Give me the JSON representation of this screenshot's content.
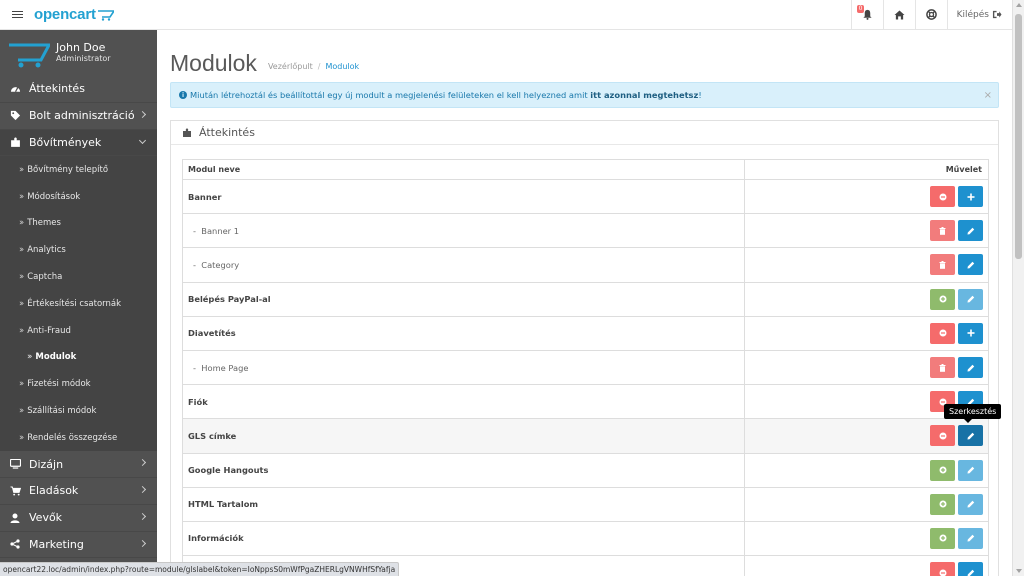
{
  "header": {
    "logo_text": "opencart",
    "notification_count": "0",
    "logout_label": "Kilépés"
  },
  "sidebar": {
    "user_name": "John Doe",
    "user_role": "Administrator",
    "items": [
      {
        "label": "Áttekintés",
        "icon": "dashboard-icon"
      },
      {
        "label": "Bolt adminisztráció",
        "icon": "tag-icon",
        "has_chevron": true
      },
      {
        "label": "Bővítmények",
        "icon": "puzzle-icon",
        "has_chevron": true,
        "open": true
      }
    ],
    "sub_items": [
      "Bővítmény telepítő",
      "Módosítások",
      "Themes",
      "Analytics",
      "Captcha",
      "Értékesítési csatornák",
      "Anti-Fraud",
      "Modulok",
      "Fizetési módok",
      "Szállítási módok",
      "Rendelés összegzése"
    ],
    "items_after": [
      {
        "label": "Dizájn",
        "icon": "desktop-icon"
      },
      {
        "label": "Eladások",
        "icon": "shopping-cart-icon"
      },
      {
        "label": "Vevők",
        "icon": "user-icon"
      },
      {
        "label": "Marketing",
        "icon": "share-icon"
      }
    ]
  },
  "page": {
    "title": "Modulok",
    "breadcrumb_home": "Vezérlőpult",
    "breadcrumb_current": "Modulok",
    "alert_text": "Miután létrehoztál és beállítottál egy új modult a megjelenési felületeken el kell helyezned amit ",
    "alert_bold": "itt azonnal megtehetsz",
    "alert_end": "!",
    "alert_close": "×",
    "panel_title": "Áttekintés"
  },
  "table": {
    "col_name": "Modul neve",
    "col_action": "Művelet",
    "rows": [
      {
        "name": "Banner",
        "type": "parent",
        "buttons": [
          "uninstall",
          "add"
        ]
      },
      {
        "name": "Banner 1",
        "type": "child",
        "buttons": [
          "delete",
          "edit"
        ]
      },
      {
        "name": "Category",
        "type": "child",
        "buttons": [
          "delete",
          "edit"
        ]
      },
      {
        "name": "Belépés PayPal-al",
        "type": "parent",
        "buttons": [
          "install",
          "edit-disabled"
        ]
      },
      {
        "name": "Diavetítés",
        "type": "parent",
        "buttons": [
          "uninstall",
          "add"
        ]
      },
      {
        "name": "Home Page",
        "type": "child",
        "buttons": [
          "delete",
          "edit"
        ]
      },
      {
        "name": "Fiók",
        "type": "parent",
        "buttons": [
          "uninstall",
          "edit"
        ]
      },
      {
        "name": "GLS címke",
        "type": "parent",
        "buttons": [
          "uninstall",
          "edit-active"
        ],
        "highlighted": true
      },
      {
        "name": "Google Hangouts",
        "type": "parent",
        "buttons": [
          "install",
          "edit-disabled"
        ]
      },
      {
        "name": "HTML Tartalom",
        "type": "parent",
        "buttons": [
          "install",
          "edit-disabled"
        ]
      },
      {
        "name": "Információk",
        "type": "parent",
        "buttons": [
          "install",
          "edit-disabled"
        ]
      },
      {
        "name": "",
        "type": "parent",
        "buttons": [
          "uninstall",
          "edit"
        ]
      }
    ]
  },
  "tooltip": "Szerkesztés",
  "status_url": "opencart22.loc/admin/index.php?route=module/glslabel&token=IoNppsS0mWfPgaZHERLgVNWHfSfYafja"
}
